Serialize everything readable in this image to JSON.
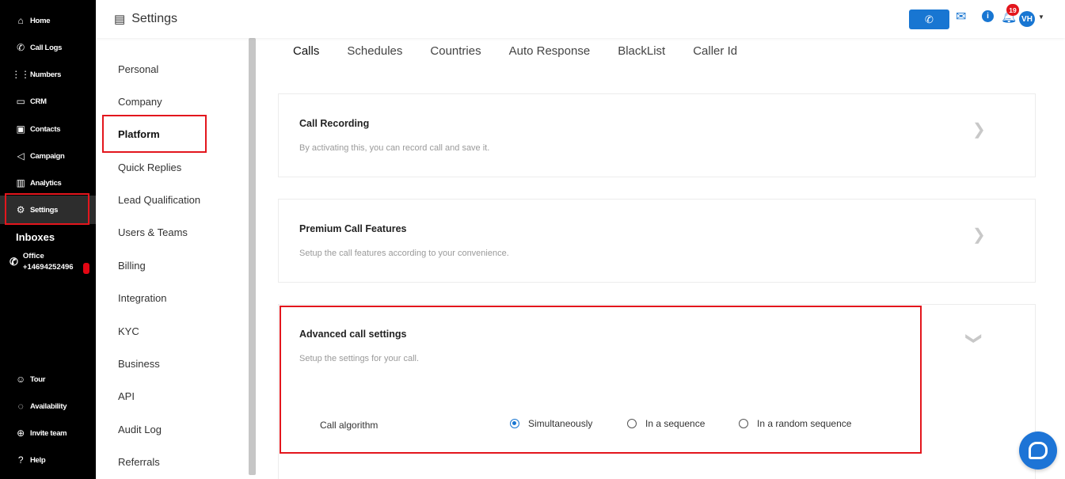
{
  "sidebar": {
    "items": [
      {
        "label": "Home",
        "icon": "home-icon",
        "glyph": "⌂"
      },
      {
        "label": "Call Logs",
        "icon": "call-logs-icon",
        "glyph": "✆"
      },
      {
        "label": "Numbers",
        "icon": "numbers-icon",
        "glyph": "⋮⋮"
      },
      {
        "label": "CRM",
        "icon": "crm-icon",
        "glyph": "▭"
      },
      {
        "label": "Contacts",
        "icon": "contacts-icon",
        "glyph": "▣"
      },
      {
        "label": "Campaign",
        "icon": "campaign-icon",
        "glyph": "◁"
      },
      {
        "label": "Analytics",
        "icon": "analytics-icon",
        "glyph": "▥"
      },
      {
        "label": "Settings",
        "icon": "gear-icon",
        "glyph": "⚙"
      }
    ],
    "inboxes_title": "Inboxes",
    "inbox": {
      "name": "Office",
      "number": "+14694252496"
    },
    "bottom_items": [
      {
        "label": "Tour",
        "icon": "tour-icon",
        "glyph": "☺"
      },
      {
        "label": "Availability",
        "icon": "availability-icon",
        "glyph": "◌"
      },
      {
        "label": "Invite team",
        "icon": "invite-icon",
        "glyph": "⊕"
      },
      {
        "label": "Help",
        "icon": "help-icon",
        "glyph": "?"
      }
    ]
  },
  "settings_nav": {
    "title": "Settings",
    "items": [
      "Personal",
      "Company",
      "Platform",
      "Quick Replies",
      "Lead Qualification",
      "Users & Teams",
      "Billing",
      "Integration",
      "KYC",
      "Business",
      "API",
      "Audit Log",
      "Referrals"
    ],
    "active": "Platform"
  },
  "header": {
    "notification_count": "19",
    "avatar_initials": "VH"
  },
  "tabs": [
    "Calls",
    "Schedules",
    "Countries",
    "Auto Response",
    "BlackList",
    "Caller Id"
  ],
  "cards": [
    {
      "title": "Call Recording",
      "subtitle": "By activating this, you can record call and save it."
    },
    {
      "title": "Premium Call Features",
      "subtitle": "Setup the call features according to your convenience."
    },
    {
      "title": "Advanced call settings",
      "subtitle": "Setup the settings for your call."
    }
  ],
  "call_algorithm": {
    "label": "Call algorithm",
    "options": [
      "Simultaneously",
      "In a sequence",
      "In a random sequence"
    ],
    "selected": "Simultaneously"
  },
  "colors": {
    "accent": "#1876d2",
    "highlight": "#e3161d",
    "sidebar_bg": "#000000"
  }
}
